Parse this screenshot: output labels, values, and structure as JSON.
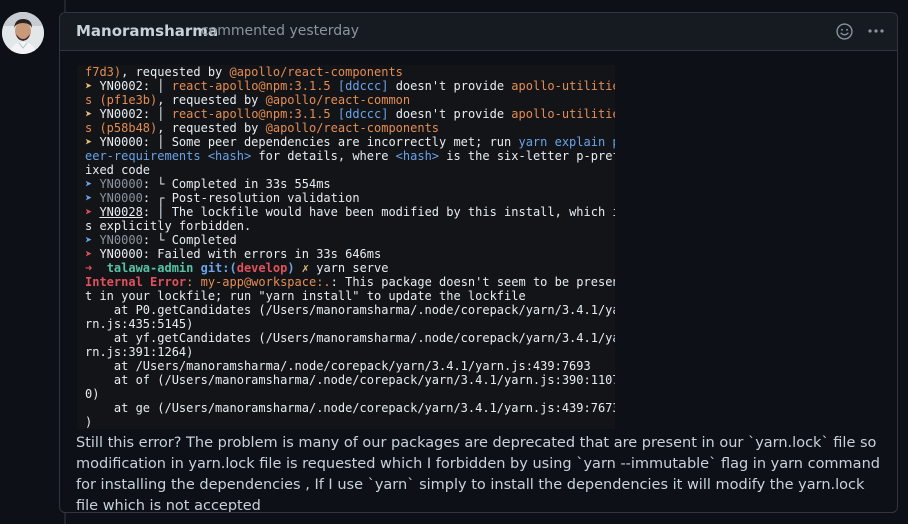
{
  "comment": {
    "author": "Manoramsharma",
    "meta": "commented yesterday",
    "body": "Still this error? The problem is many of our packages are deprecated that are present in our `yarn.lock` file so modification in yarn.lock file is requested which I forbidden by using `yarn --immutable` flag in yarn command for installing the dependencies , If I use `yarn` simply to install the dependencies it will modify the yarn.lock file which is not accepted"
  },
  "header_icons": [
    "smiley-icon",
    "kebab-horizontal-icon"
  ],
  "terminal": [
    [
      [
        "f7d3)",
        "c-orange"
      ],
      [
        ", requested by ",
        "c-white"
      ],
      [
        "@apollo/react-components",
        "c-orange"
      ]
    ],
    [
      [
        "➤ ",
        "c-yellow"
      ],
      [
        "YN0002",
        "c-white"
      ],
      [
        ": ",
        "c-white"
      ],
      [
        "│ ",
        "c-white"
      ],
      [
        "react-apollo@npm:3.1.5 ",
        "c-orange"
      ],
      [
        "[ddccc]",
        "c-blue"
      ],
      [
        " doesn't provide ",
        "c-white"
      ],
      [
        "apollo-utilitie",
        "c-orange"
      ]
    ],
    [
      [
        "s ",
        "c-orange"
      ],
      [
        "(pf1e3b)",
        "c-orange"
      ],
      [
        ", requested by ",
        "c-white"
      ],
      [
        "@apollo/react-common",
        "c-orange"
      ]
    ],
    [
      [
        "➤ ",
        "c-yellow"
      ],
      [
        "YN0002",
        "c-white"
      ],
      [
        ": ",
        "c-white"
      ],
      [
        "│ ",
        "c-white"
      ],
      [
        "react-apollo@npm:3.1.5 ",
        "c-orange"
      ],
      [
        "[ddccc]",
        "c-blue"
      ],
      [
        " doesn't provide ",
        "c-white"
      ],
      [
        "apollo-utilitie",
        "c-orange"
      ]
    ],
    [
      [
        "s ",
        "c-orange"
      ],
      [
        "(p58b48)",
        "c-orange"
      ],
      [
        ", requested by ",
        "c-white"
      ],
      [
        "@apollo/react-components",
        "c-orange"
      ]
    ],
    [
      [
        "➤ ",
        "c-yellow"
      ],
      [
        "YN0000: ",
        "c-white"
      ],
      [
        "│ Some peer dependencies are incorrectly met; run ",
        "c-white"
      ],
      [
        "yarn explain p",
        "c-blue"
      ]
    ],
    [
      [
        "eer-requirements <hash>",
        "c-blue"
      ],
      [
        " for details, where ",
        "c-white"
      ],
      [
        "<hash>",
        "c-blue"
      ],
      [
        " is the six-letter p-pref",
        "c-white"
      ]
    ],
    [
      [
        "ixed code",
        "c-white"
      ]
    ],
    [
      [
        "➤ ",
        "c-blue"
      ],
      [
        "YN0000",
        "c-gray"
      ],
      [
        ": └ Completed in 33s 554ms",
        "c-white"
      ]
    ],
    [
      [
        "➤ ",
        "c-blue"
      ],
      [
        "YN0000",
        "c-gray"
      ],
      [
        ": ┌ Post-resolution validation",
        "c-white"
      ]
    ],
    [
      [
        "➤ ",
        "c-red"
      ],
      [
        "YN0028",
        "c-white c-ul"
      ],
      [
        ": │ The lockfile would have been modified by this install, which i",
        "c-white"
      ]
    ],
    [
      [
        "s explicitly forbidden.",
        "c-white"
      ]
    ],
    [
      [
        "➤ ",
        "c-blue"
      ],
      [
        "YN0000",
        "c-gray"
      ],
      [
        ": └ Completed",
        "c-white"
      ]
    ],
    [
      [
        "➤ ",
        "c-red"
      ],
      [
        "YN0000: Failed with errors in 33s 646ms",
        "c-white"
      ]
    ],
    [
      [
        "➜  ",
        "c-red c-bold"
      ],
      [
        "talawa-admin ",
        "c-green c-bold"
      ],
      [
        "git:(",
        "c-blue c-bold"
      ],
      [
        "develop",
        "c-red c-bold"
      ],
      [
        ")",
        "c-blue c-bold"
      ],
      [
        " ✗ ",
        "c-yellow c-bold"
      ],
      [
        "yarn serve",
        "c-white"
      ]
    ],
    [
      [
        "Internal Error",
        "c-red c-bold"
      ],
      [
        ": my-app@workspace:.",
        "c-orange"
      ],
      [
        ": This package doesn't seem to be presen",
        "c-white"
      ]
    ],
    [
      [
        "t in your lockfile; run \"yarn install\" to update the lockfile",
        "c-white"
      ]
    ],
    [
      [
        "    at P0.getCandidates (/Users/manoramsharma/.node/corepack/yarn/3.4.1/ya",
        "c-white"
      ]
    ],
    [
      [
        "rn.js:435:5145)",
        "c-white"
      ]
    ],
    [
      [
        "    at yf.getCandidates (/Users/manoramsharma/.node/corepack/yarn/3.4.1/ya",
        "c-white"
      ]
    ],
    [
      [
        "rn.js:391:1264)",
        "c-white"
      ]
    ],
    [
      [
        "    at /Users/manoramsharma/.node/corepack/yarn/3.4.1/yarn.js:439:7693",
        "c-white"
      ]
    ],
    [
      [
        "    at of (/Users/manoramsharma/.node/corepack/yarn/3.4.1/yarn.js:390:1107",
        "c-white"
      ]
    ],
    [
      [
        "0)",
        "c-white"
      ]
    ],
    [
      [
        "    at ge (/Users/manoramsharma/.node/corepack/yarn/3.4.1/yarn.js:439:7673",
        "c-white"
      ]
    ],
    [
      [
        ")",
        "c-white"
      ]
    ]
  ]
}
